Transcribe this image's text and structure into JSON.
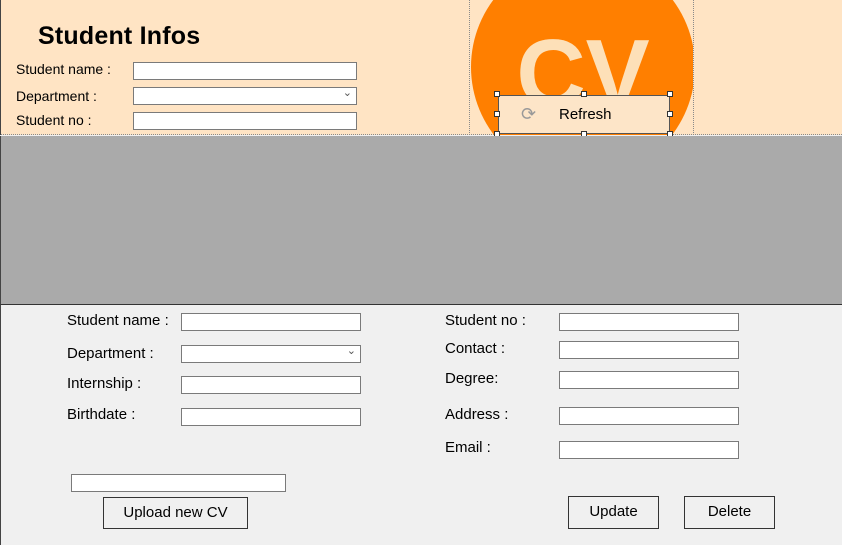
{
  "header": {
    "title": "Student Infos",
    "student_name_label": "Student name :",
    "student_name_value": "",
    "department_label": "Department :",
    "department_value": "",
    "student_no_label": "Student no :",
    "student_no_value": ""
  },
  "logo": {
    "text": "CV",
    "color": "#ff7f00",
    "text_color": "#fde0b8"
  },
  "refresh": {
    "label": "Refresh",
    "icon": "refresh-icon"
  },
  "form": {
    "student_name_label": "Student name :",
    "department_label": "Department :",
    "internship_label": "Internship :",
    "birthdate_label": "Birthdate :",
    "student_no_label": "Student no :",
    "contact_label": "Contact :",
    "degree_label": "Degree:",
    "address_label": "Address :",
    "email_label": "Email :",
    "values": {
      "student_name": "",
      "department": "",
      "internship": "",
      "birthdate": "",
      "student_no": "",
      "contact": "",
      "degree": "",
      "address": "",
      "email": "",
      "cv_path": ""
    }
  },
  "buttons": {
    "upload": "Upload new CV",
    "update": "Update",
    "delete": "Delete"
  },
  "colors": {
    "top_panel": "#ffe4c4",
    "grid_area": "#aaaaaa",
    "form_bg": "#f0f0f0"
  }
}
